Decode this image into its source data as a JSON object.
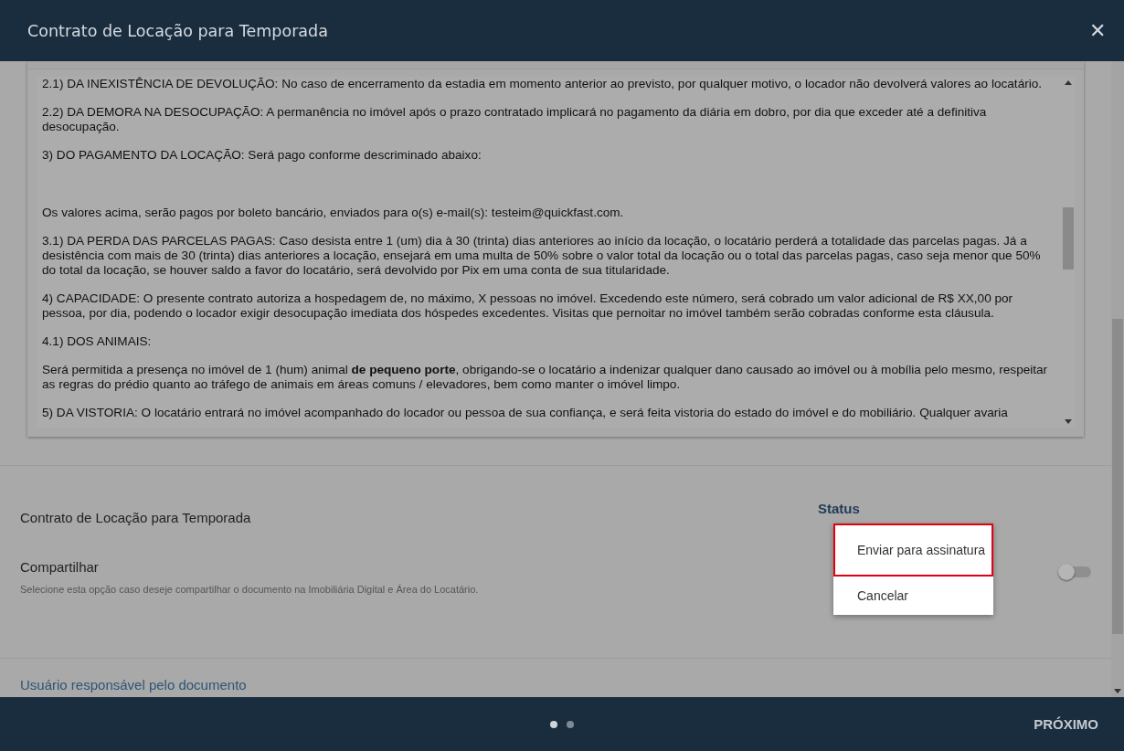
{
  "window": {
    "title": "Contrato de Locação para Temporada",
    "close": "✕"
  },
  "editor": {
    "paragraphs": [
      {
        "kind": "text",
        "text": "2.1) DA INEXISTÊNCIA DE DEVOLUÇÃO: No caso de encerramento da estadia em momento anterior ao previsto, por qualquer motivo, o locador não devolverá valores ao locatário."
      },
      {
        "kind": "text",
        "text": "2.2) DA DEMORA NA DESOCUPAÇÃO: A permanência no imóvel após o prazo contratado implicará no pagamento da diária em dobro, por dia que exceder até a definitiva desocupação."
      },
      {
        "kind": "text",
        "text": "3) DO PAGAMENTO DA LOCAÇÃO: Será pago conforme descriminado abaixo:"
      },
      {
        "kind": "blank"
      },
      {
        "kind": "text",
        "text": "Os valores acima, serão pagos por boleto bancário, enviados para o(s) e-mail(s): testeim@quickfast.com."
      },
      {
        "kind": "text",
        "text": "3.1) DA PERDA DAS PARCELAS PAGAS: Caso desista entre 1 (um) dia à 30 (trinta) dias anteriores ao início da locação, o locatário perderá a totalidade das parcelas pagas. Já a desistência com mais de 30 (trinta) dias anteriores a locação, ensejará em uma multa de 50% sobre o valor total da locação ou o total das parcelas pagas, caso seja menor que 50% do total da locação, se houver saldo a favor do locatário, será devolvido por Pix em uma conta de sua titularidade."
      },
      {
        "kind": "text",
        "text": "4) CAPACIDADE: O presente contrato autoriza a hospedagem de, no máximo, X pessoas no imóvel. Excedendo este número, será cobrado um valor adicional de R$ XX,00 por pessoa, por dia, podendo o locador exigir desocupação imediata dos hóspedes excedentes. Visitas que pernoitar no imóvel também serão cobradas conforme esta cláusula."
      },
      {
        "kind": "text",
        "text": "4.1) DOS ANIMAIS:"
      },
      {
        "kind": "text",
        "text": "Será permitida a presença no imóvel de 1 (hum) animal **de pequeno porte**, obrigando-se o locatário a indenizar qualquer dano causado ao imóvel ou à mobília pelo mesmo, respeitar as regras do prédio quanto ao tráfego de animais em áreas comuns / elevadores, bem como manter o imóvel limpo."
      },
      {
        "kind": "text",
        "text": "5) DA VISTORIA: O locatário entrará no imóvel acompanhado do locador ou pessoa de sua confiança, e será feita vistoria do estado do imóvel e do mobiliário. Qualquer avaria"
      }
    ]
  },
  "document": {
    "name": "Contrato de Locação para Temporada",
    "status_label": "Status"
  },
  "share": {
    "label": "Compartilhar",
    "hint": "Selecione esta opção caso deseje compartilhar o documento na Imobiliária Digital e Área do Locatário.",
    "on": false
  },
  "responsible": {
    "label": "Usuário responsável pelo documento"
  },
  "status_menu": [
    {
      "label": "Enviar para assinatura",
      "selected": true
    },
    {
      "label": "Cancelar",
      "selected": false
    }
  ],
  "footer": {
    "pages": [
      {
        "selected": true
      },
      {
        "selected": false
      }
    ],
    "next": "PRÓXIMO"
  }
}
